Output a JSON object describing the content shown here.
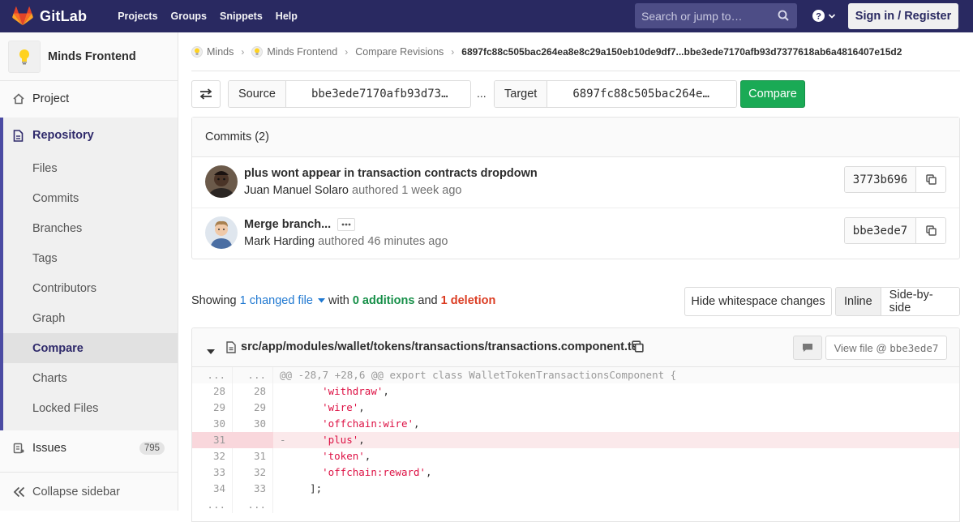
{
  "navbar": {
    "brand": "GitLab",
    "links": [
      "Projects",
      "Groups",
      "Snippets",
      "Help"
    ],
    "search_placeholder": "Search or jump to…",
    "signin_label": "Sign in / Register"
  },
  "sidebar": {
    "project_name": "Minds Frontend",
    "project_item": "Project",
    "repository_label": "Repository",
    "repo_items": [
      "Files",
      "Commits",
      "Branches",
      "Tags",
      "Contributors",
      "Graph",
      "Compare",
      "Charts",
      "Locked Files"
    ],
    "active_item": "Compare",
    "issues_label": "Issues",
    "issues_count": "795",
    "collapse_label": "Collapse sidebar"
  },
  "breadcrumb": {
    "items": [
      "Minds",
      "Minds Frontend",
      "Compare Revisions"
    ],
    "current": "6897fc88c505bac264ea8e8c29a150eb10de9df7...bbe3ede7170afb93d7377618ab6a4816407e15d2"
  },
  "compare": {
    "source_label": "Source",
    "source_value": "bbe3ede7170afb93d73…",
    "separator": "...",
    "target_label": "Target",
    "target_value": "6897fc88c505bac264e…",
    "compare_label": "Compare"
  },
  "commits": {
    "header": "Commits (2)",
    "items": [
      {
        "title": "plus wont appear in transaction contracts dropdown",
        "author": "Juan Manuel Solaro",
        "verb": "authored",
        "time": "1 week ago",
        "sha": "3773b696"
      },
      {
        "title": "Merge branch...",
        "author": "Mark Harding",
        "verb": "authored",
        "time": "46 minutes ago",
        "sha": "bbe3ede7"
      }
    ]
  },
  "summary": {
    "showing": "Showing",
    "changed_files": "1 changed file",
    "with": "with",
    "additions": "0 additions",
    "and": "and",
    "deletions": "1 deletion",
    "whitespace_label": "Hide whitespace changes",
    "inline_label": "Inline",
    "side_label": "Side-by-side"
  },
  "file": {
    "path": "src/app/modules/wallet/tokens/transactions/transactions.component.ts",
    "view_file_prefix": "View file @",
    "view_file_sha": "bbe3ede7"
  },
  "diff": {
    "hunk_header": "@@ -28,7 +28,6 @@ export class WalletTokenTransactionsComponent {",
    "lines": [
      {
        "old": "28",
        "new": "28",
        "type": "ctx",
        "prefix": "",
        "before": "    ",
        "str": "'withdraw'",
        "after": ","
      },
      {
        "old": "29",
        "new": "29",
        "type": "ctx",
        "prefix": "",
        "before": "    ",
        "str": "'wire'",
        "after": ","
      },
      {
        "old": "30",
        "new": "30",
        "type": "ctx",
        "prefix": "",
        "before": "    ",
        "str": "'offchain:wire'",
        "after": ","
      },
      {
        "old": "31",
        "new": "",
        "type": "del",
        "prefix": "-",
        "before": "    ",
        "str": "'plus'",
        "after": ","
      },
      {
        "old": "32",
        "new": "31",
        "type": "ctx",
        "prefix": "",
        "before": "    ",
        "str": "'token'",
        "after": ","
      },
      {
        "old": "33",
        "new": "32",
        "type": "ctx",
        "prefix": "",
        "before": "    ",
        "str": "'offchain:reward'",
        "after": ","
      },
      {
        "old": "34",
        "new": "33",
        "type": "ctx",
        "prefix": "",
        "before": "  ",
        "str": "",
        "after": "];"
      }
    ],
    "ellipsis": "..."
  }
}
